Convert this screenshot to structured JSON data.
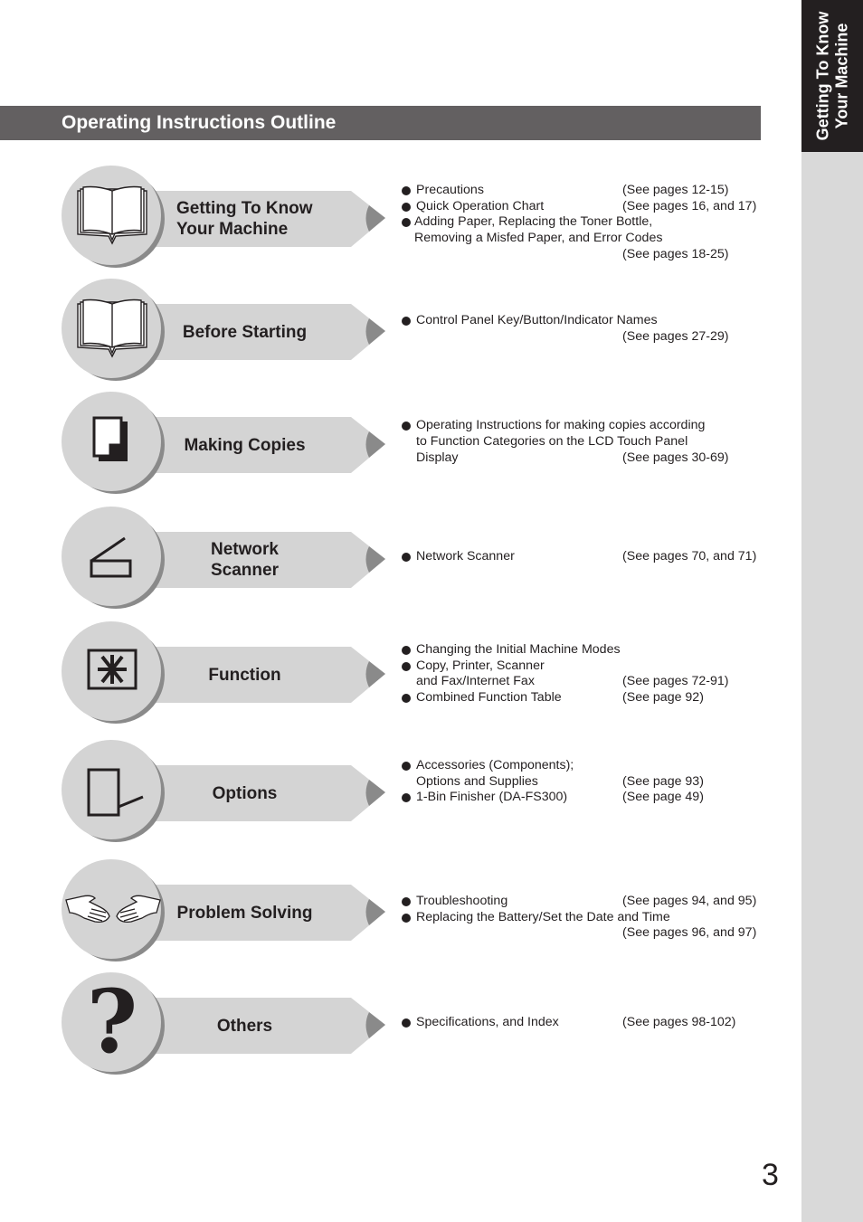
{
  "page": {
    "number": "3",
    "title": "Operating Instructions Outline",
    "side_tab": {
      "line1": "Getting To Know",
      "line2": "Your Machine"
    },
    "colors": {
      "title_bar": "#636061",
      "side_tab_active": "#231f20",
      "side_tab": "#d9d9d9",
      "arrow": "#d4d4d4",
      "arrow_tip": "#8a8a8a"
    }
  },
  "sections": [
    {
      "icon": "open-book-icon",
      "label_lines": [
        "Getting To Know",
        "Your Machine"
      ],
      "items": [
        {
          "bullet": true,
          "text": "Precautions",
          "ref": "(See pages 12-15)"
        },
        {
          "bullet": true,
          "text": "Quick Operation Chart",
          "ref": "(See pages 16, and 17)"
        },
        {
          "bullet": true,
          "tight": true,
          "text": "Adding Paper, Replacing the Toner Bottle,",
          "ref": ""
        },
        {
          "bullet": false,
          "tight": true,
          "text": "Removing a Misfed Paper, and Error Codes",
          "ref": ""
        },
        {
          "bullet": false,
          "text": "",
          "ref": "(See pages 18-25)"
        }
      ]
    },
    {
      "icon": "open-book-icon",
      "label_lines": [
        "Before Starting"
      ],
      "items": [
        {
          "bullet": true,
          "text": "Control Panel Key/Button/Indicator Names",
          "ref": ""
        },
        {
          "bullet": false,
          "text": "",
          "ref": "(See pages 27-29)"
        }
      ]
    },
    {
      "icon": "copy-document-icon",
      "label_lines": [
        "Making Copies"
      ],
      "items": [
        {
          "bullet": true,
          "text": "Operating Instructions for making copies according",
          "ref": ""
        },
        {
          "bullet": false,
          "text": "to Function Categories on the LCD Touch Panel",
          "ref": ""
        },
        {
          "bullet": false,
          "text": "Display",
          "ref": "(See pages 30-69)"
        }
      ]
    },
    {
      "icon": "scanner-icon",
      "label_lines": [
        "Network",
        "Scanner"
      ],
      "items": [
        {
          "bullet": true,
          "text": "Network Scanner",
          "ref": "(See pages 70, and 71)"
        }
      ]
    },
    {
      "icon": "function-asterisk-icon",
      "label_lines": [
        "Function"
      ],
      "items": [
        {
          "bullet": true,
          "text": "Changing the Initial Machine Modes",
          "ref": ""
        },
        {
          "bullet": true,
          "text": "Copy, Printer, Scanner",
          "ref": ""
        },
        {
          "bullet": false,
          "text": "and Fax/Internet Fax",
          "ref": "(See pages 72-91)"
        },
        {
          "bullet": true,
          "text": "Combined Function Table",
          "ref": "(See page 92)"
        }
      ]
    },
    {
      "icon": "options-tray-icon",
      "label_lines": [
        "Options"
      ],
      "items": [
        {
          "bullet": true,
          "text": "Accessories (Components);",
          "ref": ""
        },
        {
          "bullet": false,
          "text": "Options and Supplies",
          "ref": "(See page 93)"
        },
        {
          "bullet": true,
          "text": "1-Bin Finisher (DA-FS300)",
          "ref": "(See page 49)"
        }
      ]
    },
    {
      "icon": "helping-hands-icon",
      "label_lines": [
        "Problem Solving"
      ],
      "items": [
        {
          "bullet": true,
          "text": "Troubleshooting",
          "ref": "(See pages 94, and 95)"
        },
        {
          "bullet": true,
          "text": "Replacing the Battery/Set the Date and Time",
          "ref": ""
        },
        {
          "bullet": false,
          "text": "",
          "ref": "(See pages 96, and 97)"
        }
      ]
    },
    {
      "icon": "question-mark-icon",
      "label_lines": [
        "Others"
      ],
      "items": [
        {
          "bullet": true,
          "text": "Specifications, and Index",
          "ref": "(See pages 98-102)"
        }
      ]
    }
  ]
}
